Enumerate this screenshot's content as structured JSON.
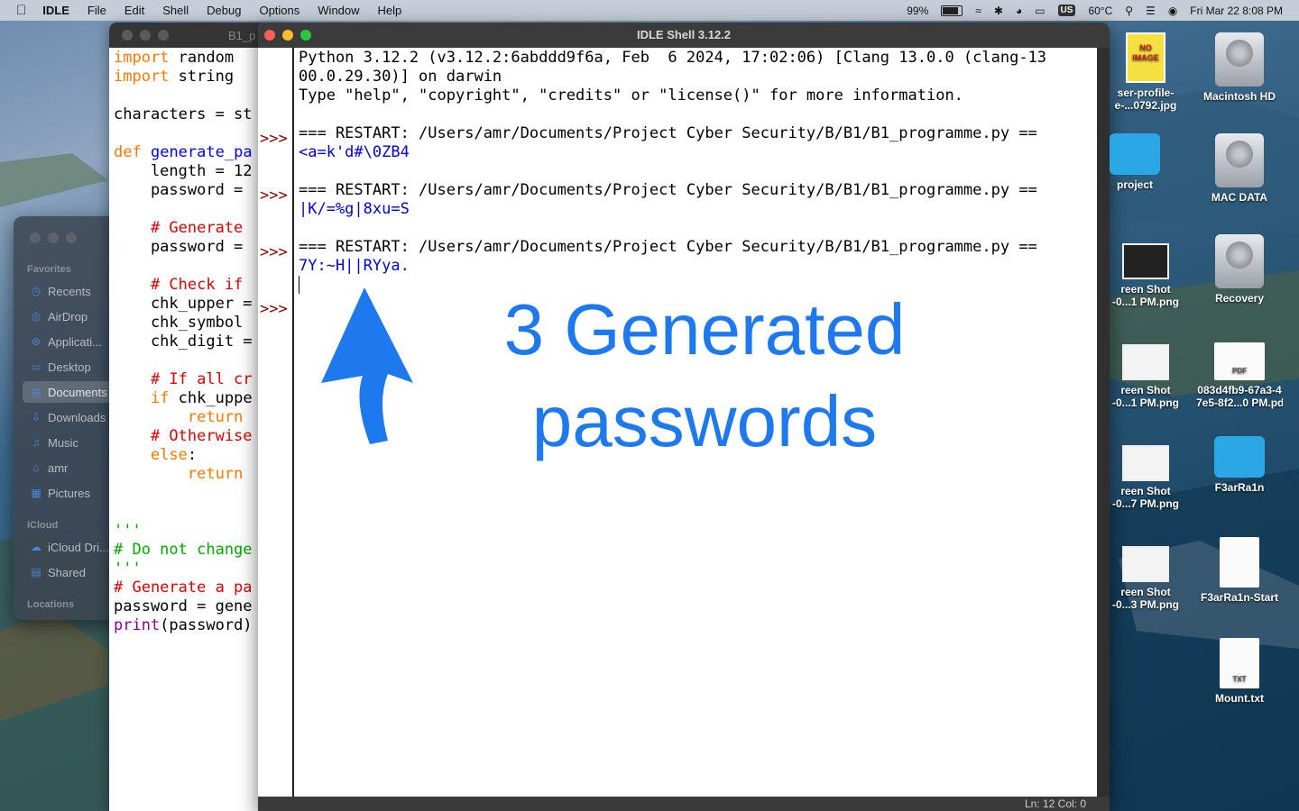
{
  "menubar": {
    "app": "IDLE",
    "items": [
      "File",
      "Edit",
      "Shell",
      "Debug",
      "Options",
      "Window",
      "Help"
    ],
    "battery": "99%",
    "keyboard": "US",
    "temperature": "60°C",
    "datetime": "Fri Mar 22  8:08 PM"
  },
  "finder": {
    "favorites_title": "Favorites",
    "favorites": [
      "Recents",
      "AirDrop",
      "Applicati...",
      "Desktop",
      "Documents",
      "Downloads",
      "Music",
      "amr",
      "Pictures"
    ],
    "icloud_title": "iCloud",
    "icloud": [
      "iCloud Dri...",
      "Shared"
    ],
    "locations_title": "Locations"
  },
  "editor": {
    "title": "B1_p",
    "lines": [
      [
        [
          "import",
          "kw"
        ],
        [
          " random",
          ""
        ]
      ],
      [
        [
          "import",
          "kw"
        ],
        [
          " string",
          ""
        ]
      ],
      [
        [
          "",
          ""
        ]
      ],
      [
        [
          "characters = st",
          ""
        ]
      ],
      [
        [
          "",
          ""
        ]
      ],
      [
        [
          "def",
          "kw"
        ],
        [
          " ",
          ""
        ],
        [
          "generate_pa",
          "fn"
        ]
      ],
      [
        [
          "    length = 12",
          ""
        ]
      ],
      [
        [
          "    password = ",
          ""
        ]
      ],
      [
        [
          "",
          ""
        ]
      ],
      [
        [
          "    # Generate ",
          "cm"
        ]
      ],
      [
        [
          "    password = ",
          ""
        ]
      ],
      [
        [
          "",
          ""
        ]
      ],
      [
        [
          "    # Check if ",
          "cm"
        ]
      ],
      [
        [
          "    chk_upper =",
          ""
        ]
      ],
      [
        [
          "    chk_symbol ",
          ""
        ]
      ],
      [
        [
          "    chk_digit =",
          ""
        ]
      ],
      [
        [
          "",
          ""
        ]
      ],
      [
        [
          "    # If all cr",
          "cm"
        ]
      ],
      [
        [
          "    ",
          ""
        ],
        [
          "if",
          "kw"
        ],
        [
          " chk_uppe",
          ""
        ]
      ],
      [
        [
          "        ",
          ""
        ],
        [
          "return",
          "kw"
        ]
      ],
      [
        [
          "    # Otherwise",
          "cm"
        ]
      ],
      [
        [
          "    ",
          ""
        ],
        [
          "else",
          "kw"
        ],
        [
          ":",
          ""
        ]
      ],
      [
        [
          "        ",
          ""
        ],
        [
          "return",
          "kw"
        ]
      ],
      [
        [
          "",
          ""
        ]
      ],
      [
        [
          "",
          ""
        ]
      ],
      [
        [
          "'''",
          "st"
        ]
      ],
      [
        [
          "# Do not change",
          "st"
        ]
      ],
      [
        [
          "'''",
          "st"
        ]
      ],
      [
        [
          "# Generate a pa",
          "cm"
        ]
      ],
      [
        [
          "password = gene",
          ""
        ]
      ],
      [
        [
          "print",
          "bi"
        ],
        [
          "(password)",
          ""
        ]
      ]
    ]
  },
  "shell": {
    "title": "IDLE Shell 3.12.2",
    "lines": [
      {
        "text": "Python 3.12.2 (v3.12.2:6abddd9f6a, Feb  6 2024, 17:02:06) [Clang 13.0.0 (clang-13",
        "cls": ""
      },
      {
        "text": "00.0.29.30)] on darwin",
        "cls": ""
      },
      {
        "text": "Type \"help\", \"copyright\", \"credits\" or \"license()\" for more information.",
        "cls": ""
      },
      {
        "text": "",
        "cls": ""
      },
      {
        "text": "=== RESTART: /Users/amr/Documents/Project Cyber Security/B/B1/B1_programme.py ==",
        "cls": ""
      },
      {
        "text": "<a=k'd#\\0ZB4",
        "cls": "out"
      },
      {
        "text": "",
        "cls": ""
      },
      {
        "text": "=== RESTART: /Users/amr/Documents/Project Cyber Security/B/B1/B1_programme.py ==",
        "cls": ""
      },
      {
        "text": "|K/=%g|8xu=S",
        "cls": "out"
      },
      {
        "text": "",
        "cls": ""
      },
      {
        "text": "=== RESTART: /Users/amr/Documents/Project Cyber Security/B/B1/B1_programme.py ==",
        "cls": ""
      },
      {
        "text": "7Y:~H||RYya.",
        "cls": "out"
      }
    ],
    "prompt": ">>>",
    "status": "Ln: 12  Col: 0",
    "annotation_line1": "3 Generated",
    "annotation_line2": "passwords"
  },
  "desktop": {
    "icons": [
      {
        "label": "ser-profile-",
        "label2": "e-...0792.jpg",
        "kind": "noimg",
        "img_text": "NO IMAGE"
      },
      {
        "label": "Macintosh HD",
        "label2": "",
        "kind": "disk"
      },
      {
        "label": "project",
        "label2": "",
        "kind": "folder"
      },
      {
        "label": "MAC DATA",
        "label2": "",
        "kind": "disk"
      },
      {
        "label": "reen Shot",
        "label2": "-0...1 PM.png",
        "kind": "thumb"
      },
      {
        "label": "Recovery",
        "label2": "",
        "kind": "disk"
      },
      {
        "label": "reen Shot",
        "label2": "-0...1 PM.png",
        "kind": "thumb-light"
      },
      {
        "label": "083d4fb9-67a3-4",
        "label2": "7e5-8f2...0 PM.pdf",
        "kind": "pdf",
        "img_text": "PDF"
      },
      {
        "label": "reen Shot",
        "label2": "-0...7 PM.png",
        "kind": "thumb-light"
      },
      {
        "label": "F3arRa1n",
        "label2": "",
        "kind": "folder"
      },
      {
        "label": "reen Shot",
        "label2": "-0...3 PM.png",
        "kind": "thumb-light"
      },
      {
        "label": "F3arRa1n-Start",
        "label2": "",
        "kind": "doc"
      },
      {
        "label": "Mount.txt",
        "label2": "",
        "kind": "txt",
        "img_text": "TXT"
      }
    ]
  },
  "colors": {
    "annotation": "#1e78ee",
    "prompt": "#8b0000",
    "output": "#0000dd"
  }
}
